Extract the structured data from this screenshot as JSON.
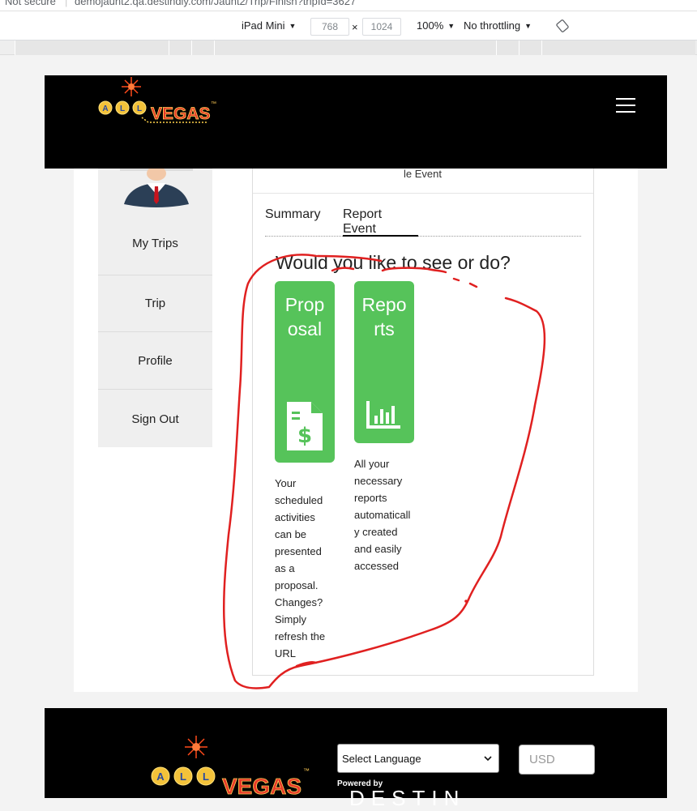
{
  "browser": {
    "security_label": "Not secure",
    "url": "demojaunt2.qa.destindly.com/Jaunt2/Trip/Finish?tripId=3627",
    "device": "iPad Mini",
    "width": "768",
    "height": "1024",
    "times": "×",
    "zoom": "100%",
    "throttling": "No throttling"
  },
  "header": {
    "logo_text_all": "ALL",
    "logo_text_vegas": "VEGAS",
    "logo_tm": "™"
  },
  "sidebar": {
    "items": [
      {
        "label": "My Trips"
      },
      {
        "label": "Trip"
      },
      {
        "label": "Profile"
      },
      {
        "label": "Sign Out"
      }
    ]
  },
  "panel": {
    "top_text": "le Event",
    "tabs": [
      {
        "label": "Summary"
      },
      {
        "label": "Report Event"
      }
    ],
    "question": "Would you like to see or do?",
    "cards": [
      {
        "title": "Proposal",
        "icon": "proposal-dollar-icon",
        "description": "Your scheduled activities can be presented as a proposal. Changes? Simply refresh the URL"
      },
      {
        "title": "Reports",
        "icon": "bar-chart-icon",
        "description": "All your necessary reports automatically created and easily accessed"
      }
    ]
  },
  "footer": {
    "language_select": "Select Language",
    "currency_placeholder": "USD",
    "powered_by": "Powered by",
    "brand": "DESTIN"
  },
  "colors": {
    "card_green": "#56c35a",
    "annotation_red": "#e02020",
    "header_bg": "#000000"
  }
}
